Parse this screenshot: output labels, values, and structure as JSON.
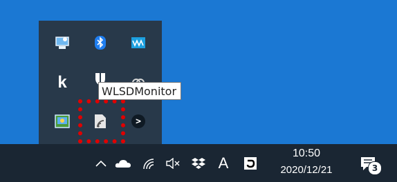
{
  "tooltip": {
    "text": "WLSDMonitor"
  },
  "tray_popup": {
    "icons": [
      {
        "name": "device-manager-icon"
      },
      {
        "name": "bluetooth-icon"
      },
      {
        "name": "waves-audio-icon"
      },
      {
        "name": "k-app-icon",
        "glyph": "k"
      },
      {
        "name": "shield-app-icon"
      },
      {
        "name": "link-app-icon"
      },
      {
        "name": "network-share-icon"
      },
      {
        "name": "wlsdmonitor-icon"
      },
      {
        "name": "terminal-app-icon",
        "glyph": ">"
      }
    ]
  },
  "taskbar": {
    "show_hidden_icons": "^",
    "language_indicator": "A",
    "clock": {
      "time": "10:50",
      "date": "2020/12/21"
    },
    "notification_badge": "3"
  },
  "colors": {
    "desktop": "#1b78d3",
    "tray_popup": "#28394a",
    "taskbar": "#1a2633",
    "highlight": "#e00000"
  }
}
